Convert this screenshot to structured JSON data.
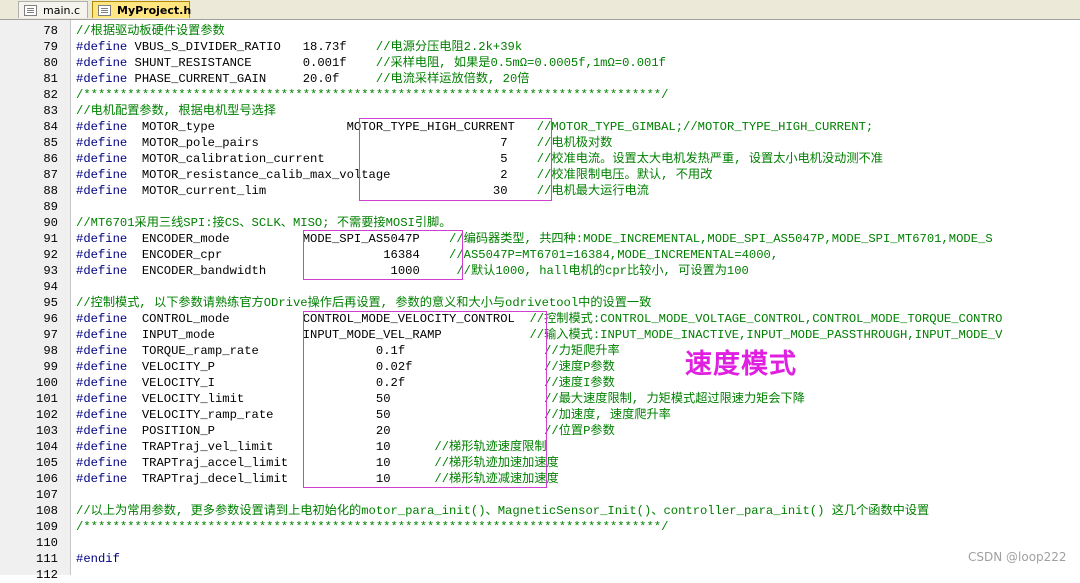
{
  "tabs": [
    {
      "label": "main.c",
      "active": false
    },
    {
      "label": "MyProject.h",
      "active": true
    }
  ],
  "lines": [
    {
      "n": "78",
      "seg": [
        {
          "c": "cmt",
          "t": "//根据驱动板硬件设置参数"
        }
      ]
    },
    {
      "n": "79",
      "seg": [
        {
          "c": "def",
          "t": "#define"
        },
        {
          "c": "id",
          "t": " VBUS_S_DIVIDER_RATIO   "
        },
        {
          "c": "num",
          "t": "18.73f"
        },
        {
          "c": "cmt",
          "t": "    //电源分压电阻2.2k+39k"
        }
      ]
    },
    {
      "n": "80",
      "seg": [
        {
          "c": "def",
          "t": "#define"
        },
        {
          "c": "id",
          "t": " SHUNT_RESISTANCE       "
        },
        {
          "c": "num",
          "t": "0.001f"
        },
        {
          "c": "cmt",
          "t": "    //采样电阻, 如果是0.5mΩ=0.0005f,1mΩ=0.001f"
        }
      ]
    },
    {
      "n": "81",
      "seg": [
        {
          "c": "def",
          "t": "#define"
        },
        {
          "c": "id",
          "t": " PHASE_CURRENT_GAIN     "
        },
        {
          "c": "num",
          "t": "20.0f"
        },
        {
          "c": "cmt",
          "t": "     //电流采样运放倍数, 20倍"
        }
      ]
    },
    {
      "n": "82",
      "seg": [
        {
          "c": "cmt",
          "t": "/*******************************************************************************/"
        }
      ]
    },
    {
      "n": "83",
      "seg": [
        {
          "c": "cmt",
          "t": "//电机配置参数, 根据电机型号选择"
        }
      ]
    },
    {
      "n": "84",
      "seg": [
        {
          "c": "def",
          "t": "#define"
        },
        {
          "c": "id",
          "t": "  MOTOR_type                  MOTOR_TYPE_HIGH_CURRENT"
        },
        {
          "c": "cmt",
          "t": "   //MOTOR_TYPE_GIMBAL;//MOTOR_TYPE_HIGH_CURRENT;"
        }
      ]
    },
    {
      "n": "85",
      "seg": [
        {
          "c": "def",
          "t": "#define"
        },
        {
          "c": "id",
          "t": "  MOTOR_pole_pairs                                 "
        },
        {
          "c": "num",
          "t": "7"
        },
        {
          "c": "cmt",
          "t": "    //电机极对数"
        }
      ]
    },
    {
      "n": "86",
      "seg": [
        {
          "c": "def",
          "t": "#define"
        },
        {
          "c": "id",
          "t": "  MOTOR_calibration_current                        "
        },
        {
          "c": "num",
          "t": "5"
        },
        {
          "c": "cmt",
          "t": "    //校准电流。设置太大电机发热严重, 设置太小电机没动测不准"
        }
      ]
    },
    {
      "n": "87",
      "seg": [
        {
          "c": "def",
          "t": "#define"
        },
        {
          "c": "id",
          "t": "  MOTOR_resistance_calib_max_voltage               "
        },
        {
          "c": "num",
          "t": "2"
        },
        {
          "c": "cmt",
          "t": "    //校准限制电压。默认, 不用改"
        }
      ]
    },
    {
      "n": "88",
      "seg": [
        {
          "c": "def",
          "t": "#define"
        },
        {
          "c": "id",
          "t": "  MOTOR_current_lim                               "
        },
        {
          "c": "num",
          "t": "30"
        },
        {
          "c": "cmt",
          "t": "    //电机最大运行电流"
        }
      ]
    },
    {
      "n": "89",
      "seg": []
    },
    {
      "n": "90",
      "seg": [
        {
          "c": "cmt",
          "t": "//MT6701采用三线SPI:接CS、SCLK、MISO; 不需要接MOSI引脚。"
        }
      ]
    },
    {
      "n": "91",
      "seg": [
        {
          "c": "def",
          "t": "#define"
        },
        {
          "c": "id",
          "t": "  ENCODER_mode          MODE_SPI_AS5047P"
        },
        {
          "c": "cmt",
          "t": "    //编码器类型, 共四种:MODE_INCREMENTAL,MODE_SPI_AS5047P,MODE_SPI_MT6701,MODE_S"
        }
      ]
    },
    {
      "n": "92",
      "seg": [
        {
          "c": "def",
          "t": "#define"
        },
        {
          "c": "id",
          "t": "  ENCODER_cpr                      "
        },
        {
          "c": "num",
          "t": "16384"
        },
        {
          "c": "cmt",
          "t": "    //AS5047P=MT6701=16384,MODE_INCREMENTAL=4000,"
        }
      ]
    },
    {
      "n": "93",
      "seg": [
        {
          "c": "def",
          "t": "#define"
        },
        {
          "c": "id",
          "t": "  ENCODER_bandwidth                 "
        },
        {
          "c": "num",
          "t": "1000"
        },
        {
          "c": "cmt",
          "t": "     //默认1000, hall电机的cpr比较小, 可设置为100"
        }
      ]
    },
    {
      "n": "94",
      "seg": []
    },
    {
      "n": "95",
      "seg": [
        {
          "c": "cmt",
          "t": "//控制模式, 以下参数请熟练官方ODrive操作后再设置, 参数的意义和大小与odrivetool中的设置一致"
        }
      ]
    },
    {
      "n": "96",
      "seg": [
        {
          "c": "def",
          "t": "#define"
        },
        {
          "c": "id",
          "t": "  CONTROL_mode          CONTROL_MODE_VELOCITY_CONTROL"
        },
        {
          "c": "cmt",
          "t": "  //控制模式:CONTROL_MODE_VOLTAGE_CONTROL,CONTROL_MODE_TORQUE_CONTRO"
        }
      ]
    },
    {
      "n": "97",
      "seg": [
        {
          "c": "def",
          "t": "#define"
        },
        {
          "c": "id",
          "t": "  INPUT_mode            INPUT_MODE_VEL_RAMP"
        },
        {
          "c": "cmt",
          "t": "            //输入模式:INPUT_MODE_INACTIVE,INPUT_MODE_PASSTHROUGH,INPUT_MODE_V"
        }
      ]
    },
    {
      "n": "98",
      "seg": [
        {
          "c": "def",
          "t": "#define"
        },
        {
          "c": "id",
          "t": "  TORQUE_ramp_rate                "
        },
        {
          "c": "num",
          "t": "0.1f"
        },
        {
          "c": "cmt",
          "t": "                   //力矩爬升率"
        }
      ]
    },
    {
      "n": "99",
      "seg": [
        {
          "c": "def",
          "t": "#define"
        },
        {
          "c": "id",
          "t": "  VELOCITY_P                      "
        },
        {
          "c": "num",
          "t": "0.02f"
        },
        {
          "c": "cmt",
          "t": "                  //速度P参数"
        }
      ]
    },
    {
      "n": "100",
      "seg": [
        {
          "c": "def",
          "t": "#define"
        },
        {
          "c": "id",
          "t": "  VELOCITY_I                      "
        },
        {
          "c": "num",
          "t": "0.2f"
        },
        {
          "c": "cmt",
          "t": "                   //速度I参数"
        }
      ]
    },
    {
      "n": "101",
      "seg": [
        {
          "c": "def",
          "t": "#define"
        },
        {
          "c": "id",
          "t": "  VELOCITY_limit                  "
        },
        {
          "c": "num",
          "t": "50"
        },
        {
          "c": "cmt",
          "t": "                     //最大速度限制, 力矩模式超过限速力矩会下降"
        }
      ]
    },
    {
      "n": "102",
      "seg": [
        {
          "c": "def",
          "t": "#define"
        },
        {
          "c": "id",
          "t": "  VELOCITY_ramp_rate              "
        },
        {
          "c": "num",
          "t": "50"
        },
        {
          "c": "cmt",
          "t": "                     //加速度, 速度爬升率"
        }
      ]
    },
    {
      "n": "103",
      "seg": [
        {
          "c": "def",
          "t": "#define"
        },
        {
          "c": "id",
          "t": "  POSITION_P                      "
        },
        {
          "c": "num",
          "t": "20"
        },
        {
          "c": "cmt",
          "t": "                     //位置P参数"
        }
      ]
    },
    {
      "n": "104",
      "seg": [
        {
          "c": "def",
          "t": "#define"
        },
        {
          "c": "id",
          "t": "  TRAPTraj_vel_limit              "
        },
        {
          "c": "num",
          "t": "10"
        },
        {
          "c": "cmt",
          "t": "      //梯形轨迹速度限制"
        }
      ]
    },
    {
      "n": "105",
      "seg": [
        {
          "c": "def",
          "t": "#define"
        },
        {
          "c": "id",
          "t": "  TRAPTraj_accel_limit            "
        },
        {
          "c": "num",
          "t": "10"
        },
        {
          "c": "cmt",
          "t": "      //梯形轨迹加速加速度"
        }
      ]
    },
    {
      "n": "106",
      "seg": [
        {
          "c": "def",
          "t": "#define"
        },
        {
          "c": "id",
          "t": "  TRAPTraj_decel_limit            "
        },
        {
          "c": "num",
          "t": "10"
        },
        {
          "c": "cmt",
          "t": "      //梯形轨迹减速加速度"
        }
      ]
    },
    {
      "n": "107",
      "seg": []
    },
    {
      "n": "108",
      "seg": [
        {
          "c": "cmt",
          "t": "//以上为常用参数, 更多参数设置请到上电初始化的motor_para_init()、MagneticSensor_Init()、controller_para_init() 这几个函数中设置"
        }
      ]
    },
    {
      "n": "109",
      "seg": [
        {
          "c": "cmt",
          "t": "/*******************************************************************************/"
        }
      ]
    },
    {
      "n": "110",
      "seg": []
    },
    {
      "n": "111",
      "seg": [
        {
          "c": "def",
          "t": "#endif"
        }
      ]
    },
    {
      "n": "112",
      "seg": []
    }
  ],
  "annotation": "速度模式",
  "watermark": "CSDN @loop222",
  "colors": {
    "box": "#d040d0",
    "annotation": "#e020e0",
    "comment": "#008000",
    "keyword": "#000080"
  }
}
